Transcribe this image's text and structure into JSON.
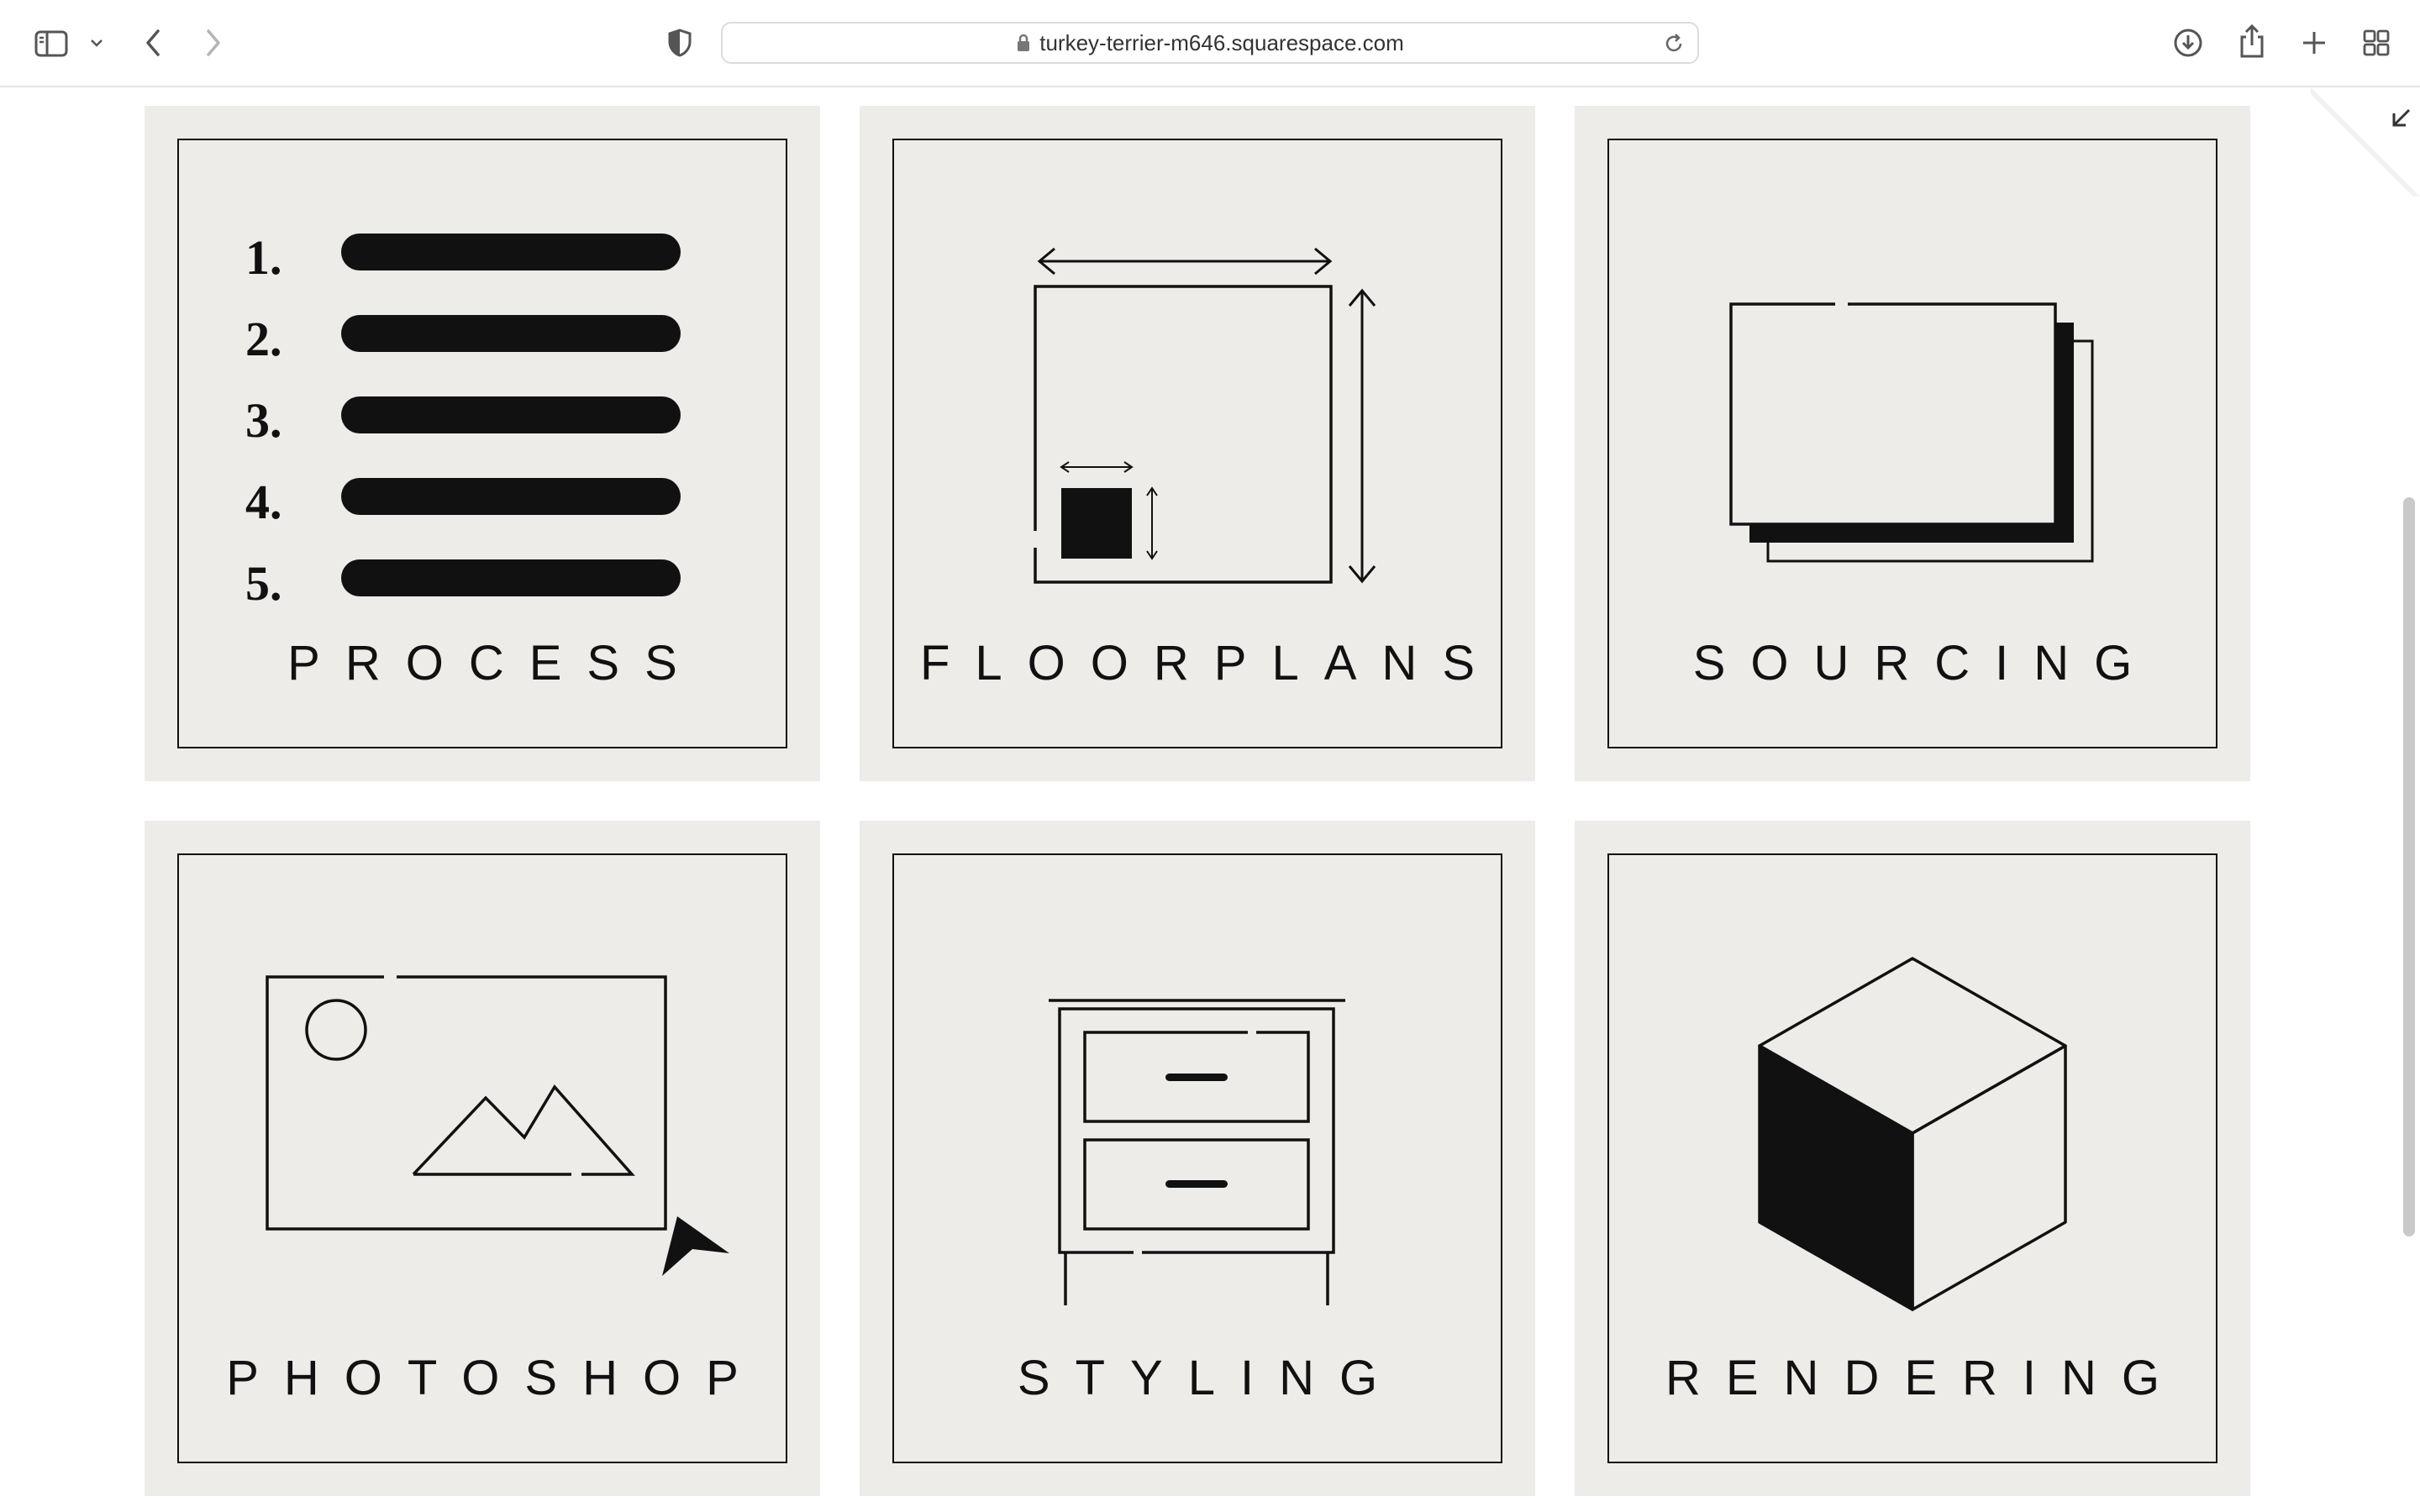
{
  "browser": {
    "url": "turkey-terrier-m646.squarespace.com",
    "icons": {
      "sidebar": "sidebar-icon",
      "sidebar_menu": "chevron-down-icon",
      "back": "chevron-left-icon",
      "forward": "chevron-right-icon",
      "privacy": "shield-icon",
      "lock": "lock-icon",
      "reload": "reload-icon",
      "download": "download-icon",
      "share": "share-icon",
      "new_tab": "plus-icon",
      "tab_overview": "grid-icon",
      "exit_fullscreen": "collapse-arrow-icon"
    }
  },
  "services": [
    {
      "label": "PROCESS",
      "icon": "numbered-list-icon",
      "list_numbers": [
        "1.",
        "2.",
        "3.",
        "4.",
        "5."
      ]
    },
    {
      "label": "FLOORPLANS",
      "icon": "floorplan-icon"
    },
    {
      "label": "SOURCING",
      "icon": "stacked-cards-icon"
    },
    {
      "label": "PHOTOSHOP",
      "icon": "image-cursor-icon"
    },
    {
      "label": "STYLING",
      "icon": "nightstand-icon"
    },
    {
      "label": "RENDERING",
      "icon": "cube-icon"
    }
  ],
  "colors": {
    "card_background": "#eeece9",
    "ink": "#111111",
    "page_background": "#ffffff"
  }
}
